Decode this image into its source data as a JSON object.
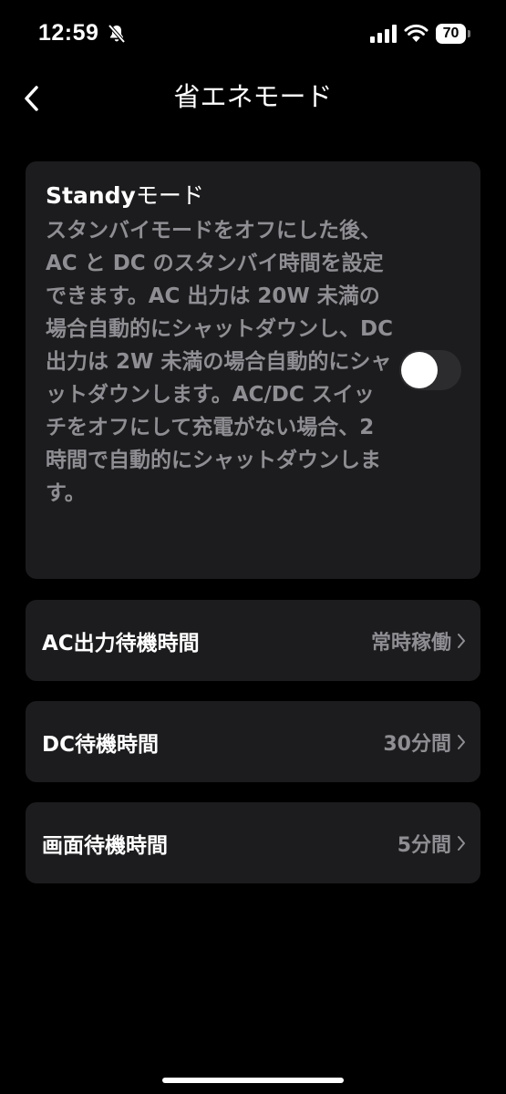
{
  "status_bar": {
    "time": "12:59",
    "battery_level": "70",
    "icons": [
      "bell-slash-icon",
      "cellular-signal-icon",
      "wifi-icon",
      "battery-icon"
    ]
  },
  "nav": {
    "title": "省エネモード",
    "back_icon": "chevron-left-icon"
  },
  "standby": {
    "title_en": "Standy",
    "title_jp": "モード",
    "description": "スタンバイモードをオフにした後、AC と DC のスタンバイ時間を設定できます。AC 出力は 20W 未満の場合自動的にシャットダウンし、DC 出力は 2W 未満の場合自動的にシャットダウンします。AC/DC スイッチをオフにして充電がない場合、2 時間で自動的にシャットダウンします。",
    "toggle_on": false
  },
  "settings": [
    {
      "label": "AC出力待機時間",
      "value": "常時稼働"
    },
    {
      "label": "DC待機時間",
      "value": "30分間"
    },
    {
      "label": "画面待機時間",
      "value": "5分間"
    }
  ],
  "colors": {
    "background": "#000000",
    "card": "#1c1c1e",
    "secondary_text": "#8e8e93",
    "toggle_off_track": "#2c2c2e"
  }
}
